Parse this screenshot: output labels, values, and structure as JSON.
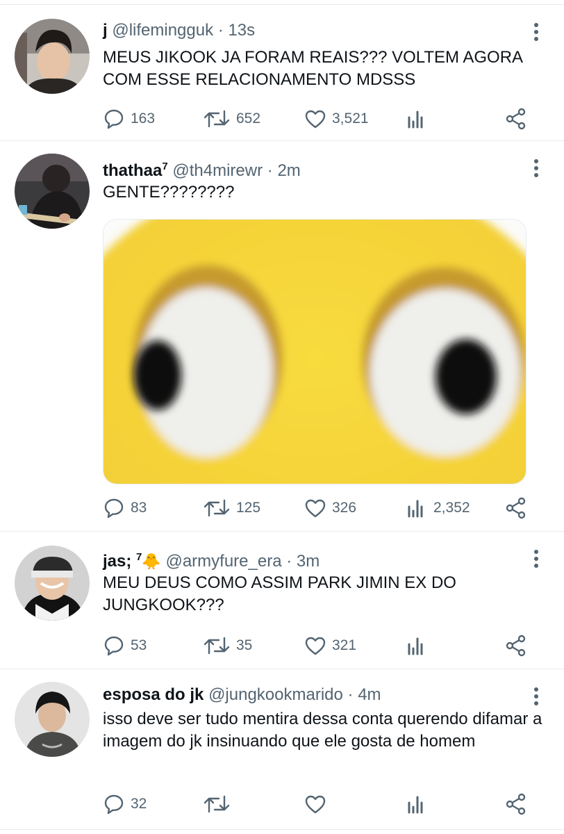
{
  "tweets": [
    {
      "name": "j",
      "badge": "",
      "handle": "@lifemingguk",
      "time": "13s",
      "text": "MEUS JIKOOK JA FORAM REAIS??? VOLTEM AGORA COM ESSE RELACIONAMENTO MDSSS",
      "replies": "163",
      "retweets": "652",
      "likes": "3,521",
      "views": ""
    },
    {
      "name": "thathaa",
      "badge": "7",
      "handle": "@th4mirewr",
      "time": "2m",
      "text": "GENTE????????",
      "replies": "83",
      "retweets": "125",
      "likes": "326",
      "views": "2,352"
    },
    {
      "name": "jas;",
      "badge": "7",
      "emoji": "🐥",
      "handle": "@armyfure_era",
      "time": "3m",
      "text": "MEU DEUS COMO ASSIM PARK JIMIN EX DO JUNGKOOK???",
      "replies": "53",
      "retweets": "35",
      "likes": "321",
      "views": ""
    },
    {
      "name": "esposa do jk",
      "badge": "",
      "handle": "@jungkookmarido",
      "time": "4m",
      "text": "isso deve ser tudo mentira dessa conta querendo difamar a imagem do jk insinuando que ele gosta de homem",
      "replies": "32",
      "retweets": "",
      "likes": "",
      "views": ""
    }
  ],
  "separator": "·",
  "colors": {
    "text": "#0f1419",
    "muted": "#536471",
    "border": "#e6ecf0",
    "emoji_yellow": "#f5d33a"
  },
  "icons": [
    "reply-icon",
    "retweet-icon",
    "like-icon",
    "views-icon",
    "share-icon",
    "more-icon"
  ]
}
